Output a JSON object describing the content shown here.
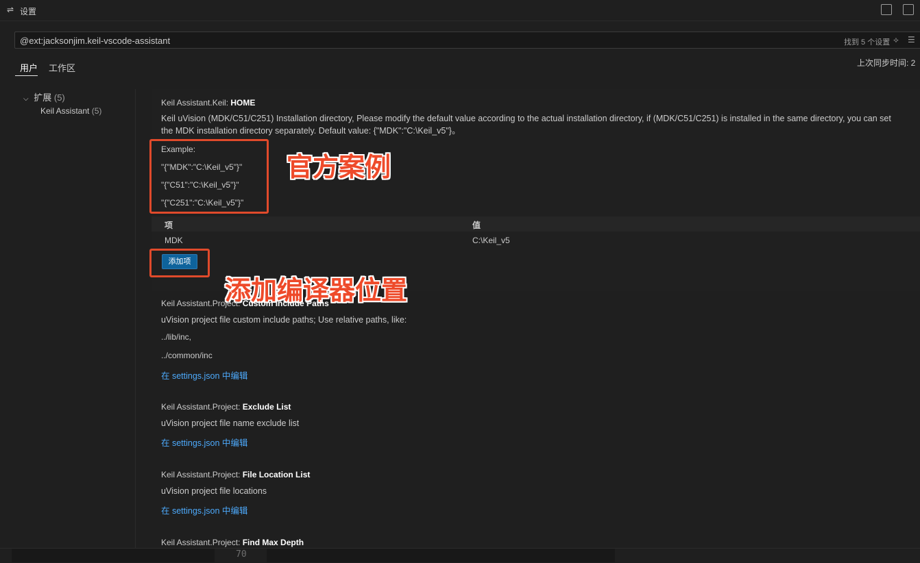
{
  "title_bar": {
    "tab_title": "设置"
  },
  "search": {
    "value": "@ext:jacksonjim.keil-vscode-assistant",
    "result_count": "找到 5 个设置"
  },
  "scope_tabs": [
    {
      "label": "用户"
    },
    {
      "label": "工作区"
    }
  ],
  "sync_status": "上次同步时间: 2",
  "toc": {
    "group_label": "扩展",
    "group_count": "(5)",
    "item_label": "Keil Assistant",
    "item_count": "(5)"
  },
  "settings": [
    {
      "category": "Keil Assistant.Keil: ",
      "name": "HOME",
      "description_line1": "Keil uVision (MDK/C51/C251) Installation directory, Please modify the default value according to the actual installation directory, if (MDK/C51/C251) is installed in the same directory, you can set",
      "description_line2": "the MDK installation directory separately. Default value: {\"MDK\":\"C:\\Keil_v5\"}。",
      "examples": [
        "Example:",
        "\"{\"MDK\":\"C:\\Keil_v5\"}\"",
        "\"{\"C51\":\"C:\\Keil_v5\"}\"",
        "\"{\"C251\":\"C:\\Keil_v5\"}\""
      ],
      "table": {
        "headers": [
          "项",
          "值"
        ],
        "rows": [
          {
            "key": "MDK",
            "value": "C:\\Keil_v5"
          }
        ]
      },
      "add_button": "添加项"
    },
    {
      "category": "Keil Assistant.Project: ",
      "name": "Custom Include Paths",
      "description": "uVision project file custom include paths; Use relative paths, like:",
      "lines": [
        "../lib/inc,",
        "../common/inc"
      ],
      "link": "在 settings.json 中编辑"
    },
    {
      "category": "Keil Assistant.Project: ",
      "name": "Exclude List",
      "description": "uVision project file name exclude list",
      "link": "在 settings.json 中编辑"
    },
    {
      "category": "Keil Assistant.Project: ",
      "name": "File Location List",
      "description": "uVision project file locations",
      "link": "在 settings.json 中编辑"
    },
    {
      "category": "Keil Assistant.Project: ",
      "name": "Find Max Depth"
    }
  ],
  "annotations": {
    "example_note": "官方案例",
    "add_note": "添加编译器位置",
    "color": "#e04a2b"
  },
  "bottom_bar": {
    "number": "70"
  }
}
